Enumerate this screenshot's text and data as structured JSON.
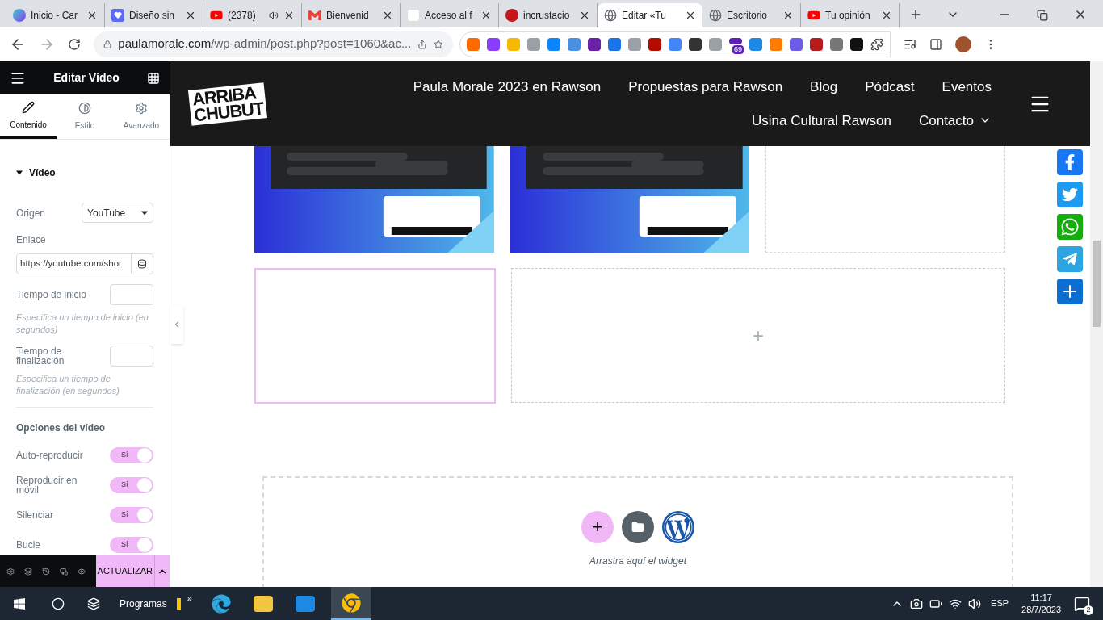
{
  "browser": {
    "tabs": [
      {
        "title": "Inicio - Car",
        "selected": false
      },
      {
        "title": "Diseño sin",
        "selected": false
      },
      {
        "title": "(2378)",
        "selected": false,
        "audio": true
      },
      {
        "title": "Bienvenid",
        "selected": false
      },
      {
        "title": "Acceso al f",
        "selected": false
      },
      {
        "title": "incrustacio",
        "selected": false
      },
      {
        "title": "Editar «Tu",
        "selected": true
      },
      {
        "title": "Escritorio",
        "selected": false
      },
      {
        "title": "Tu opinión",
        "selected": false
      }
    ],
    "url_host": "paulamorale.com",
    "url_path": "/wp-admin/post.php?post=1060&ac...",
    "extension_badge": "69"
  },
  "panel": {
    "title": "Editar Vídeo",
    "tabs": [
      {
        "label": "Contenido",
        "selected": true
      },
      {
        "label": "Estilo",
        "selected": false
      },
      {
        "label": "Avanzado",
        "selected": false
      }
    ],
    "section": "Vídeo",
    "expanded": true,
    "origin": {
      "label": "Origen",
      "value": "YouTube"
    },
    "link": {
      "label": "Enlace",
      "value": "https://youtube.com/shor"
    },
    "start": {
      "label": "Tiempo de inicio",
      "hint": "Especifica un tiempo de inicio (en segundos)"
    },
    "end": {
      "label": "Tiempo de finalización",
      "hint": "Especifica un tiempo de finalización (en segundos)"
    },
    "options_title": "Opciones del vídeo",
    "toggles": [
      {
        "label": "Auto-reproducir",
        "text": "Sí",
        "on": true
      },
      {
        "label": "Reproducir en móvil",
        "text": "Sí",
        "on": true
      },
      {
        "label": "Silenciar",
        "text": "Sí",
        "on": true
      },
      {
        "label": "Bucle",
        "text": "Sí",
        "on": true
      }
    ],
    "update_button": "ACTUALIZAR"
  },
  "site": {
    "logo": [
      "ARRIBA",
      "CHUBUT"
    ],
    "nav": [
      {
        "label": "Paula Morale 2023 en Rawson",
        "dropdown": false
      },
      {
        "label": "Propuestas para Rawson",
        "dropdown": false
      },
      {
        "label": "Blog",
        "dropdown": false
      },
      {
        "label": "Pódcast",
        "dropdown": false
      },
      {
        "label": "Eventos",
        "dropdown": false
      },
      {
        "label": "Usina Cultural Rawson",
        "dropdown": false
      },
      {
        "label": "Contacto",
        "dropdown": true
      }
    ],
    "add_mark": "+",
    "drop_hint": "Arrastra aquí el widget",
    "drop_button": "+"
  },
  "taskbar": {
    "search_label": "Programas",
    "overflow": "»",
    "language": "ESP",
    "time": "11:17",
    "date": "28/7/2023",
    "notifications": "2"
  }
}
